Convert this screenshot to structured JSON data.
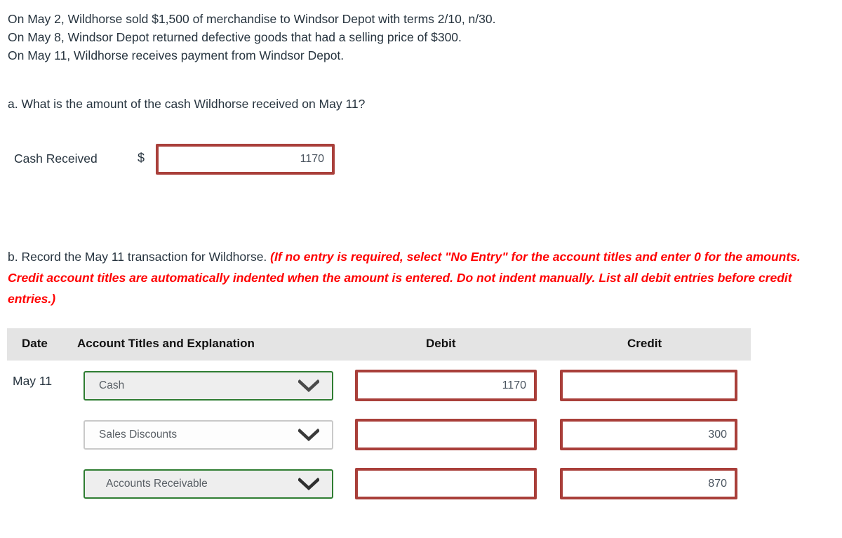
{
  "intro": {
    "lines": [
      "On May 2, Wildhorse sold $1,500 of merchandise to Windsor Depot with terms 2/10, n/30.",
      "On May 8, Windsor Depot returned defective goods that had a selling price of $300.",
      "On May 11, Wildhorse receives payment from Windsor Depot."
    ]
  },
  "part_a": {
    "question": "a. What is the amount of the cash Wildhorse received on May 11?",
    "label": "Cash Received",
    "currency_symbol": "$",
    "input_value": "1170",
    "input_placeholder": ""
  },
  "part_b": {
    "prompt": "b. Record the May 11 transaction for Wildhorse.",
    "hint": "(If no entry is required, select \"No Entry\" for the account titles and enter 0 for the amounts. Credit account titles are automatically indented when the amount is entered. Do not indent manually. List all debit entries before credit entries.)",
    "table": {
      "headers": {
        "date": "Date",
        "account": "Account Titles and Explanation",
        "debit": "Debit",
        "credit": "Credit"
      },
      "rows": [
        {
          "date": "May 11",
          "account": "Cash",
          "account_state": "valid",
          "indent": false,
          "debit": "1170",
          "credit": ""
        },
        {
          "date": "",
          "account": "Sales Discounts",
          "account_state": "neutral",
          "indent": false,
          "debit": "",
          "credit": "300"
        },
        {
          "date": "",
          "account": "Accounts Receivable",
          "account_state": "valid",
          "indent": true,
          "debit": "",
          "credit": "870"
        }
      ]
    }
  },
  "colors": {
    "input_border_red": "#a93f3a",
    "select_border_green": "#2f7d32",
    "select_border_neutral": "#c9c9c9",
    "hint_red": "#ff0000",
    "header_band": "#e4e4e4",
    "text": "#27343f"
  },
  "icons": {
    "chevron": "chevron-down-icon"
  }
}
